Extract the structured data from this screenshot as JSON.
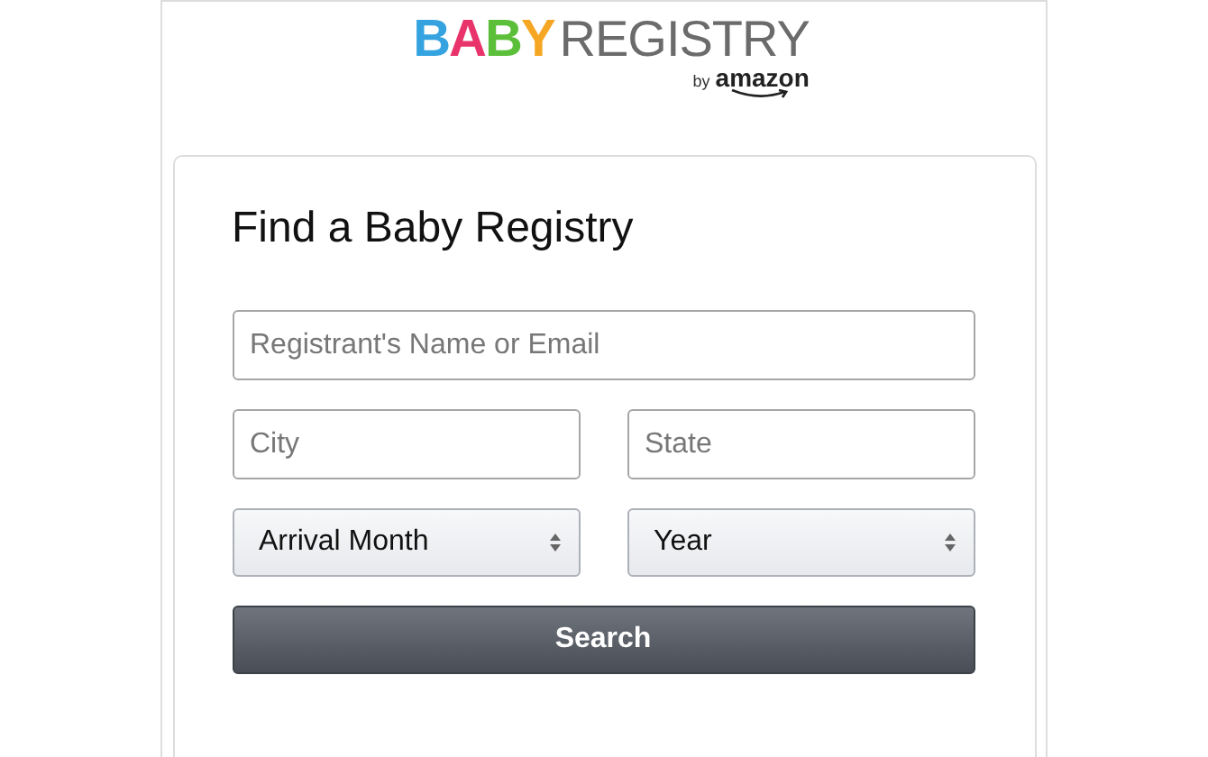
{
  "logo": {
    "letters": [
      {
        "text": "B",
        "color": "#35a3e0"
      },
      {
        "text": "A",
        "color": "#e8336b"
      },
      {
        "text": "B",
        "color": "#5cbf3a"
      },
      {
        "text": "Y",
        "color": "#f5a623"
      }
    ],
    "word": "REGISTRY",
    "byline": "by",
    "brand": "amazon"
  },
  "form": {
    "title": "Find a Baby Registry",
    "fields": [
      {
        "kind": "text",
        "placeholder": "Registrant's Name or Email",
        "wide": true
      },
      {
        "kind": "text",
        "placeholder": "City",
        "wide": false
      },
      {
        "kind": "text",
        "placeholder": "State",
        "wide": false
      },
      {
        "kind": "select",
        "value": "Arrival Month",
        "wide": false
      },
      {
        "kind": "select",
        "value": "Year",
        "wide": false
      }
    ],
    "button": "Search"
  }
}
